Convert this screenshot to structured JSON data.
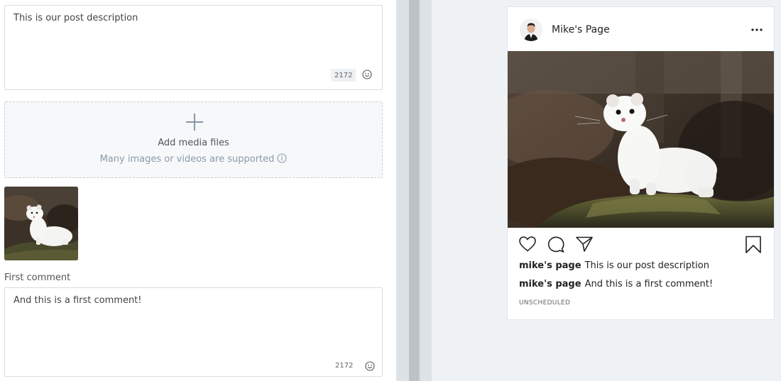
{
  "editor": {
    "description": {
      "text": "This is our post description",
      "counter": "2172"
    },
    "media": {
      "title": "Add media files",
      "subtitle": "Many images or videos are supported"
    },
    "first_comment": {
      "label": "First comment",
      "text": "And this is a first comment!",
      "counter": "2172"
    }
  },
  "preview": {
    "page_name": "Mike's Page",
    "caption": {
      "user": "mike's page",
      "text": "This is our post description"
    },
    "comment": {
      "user": "mike's page",
      "text": "And this is a first comment!"
    },
    "status": "UNSCHEDULED"
  },
  "icons": {
    "emoji": "smiley-icon",
    "plus": "plus-icon",
    "info": "info-icon",
    "more": "more-dots-icon",
    "like": "heart-icon",
    "comment": "comment-bubble-icon",
    "share": "paper-plane-icon",
    "save": "bookmark-icon"
  },
  "colors": {
    "accent_gray": "#8b9aa8",
    "border": "#d7dde3",
    "preview_bg": "#eff2f5"
  }
}
